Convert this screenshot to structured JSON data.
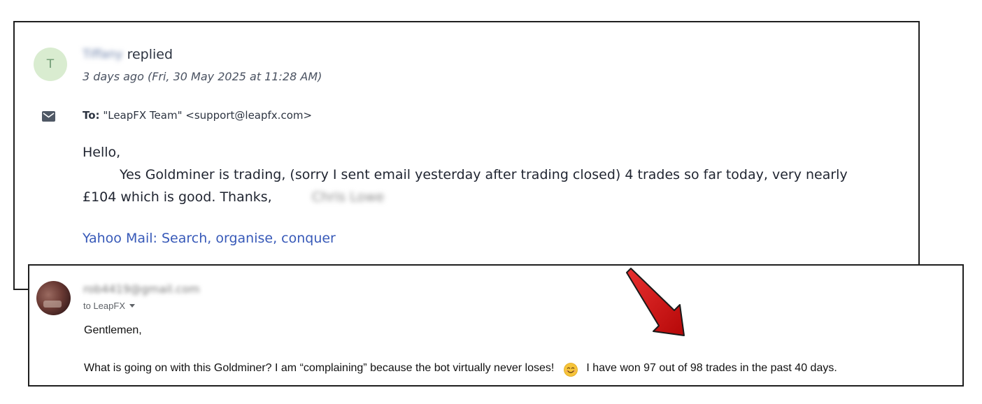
{
  "reply": {
    "avatar_letter": "T",
    "sender_name": "Tiffany",
    "replied_label": "replied",
    "date": "3 days ago (Fri, 30 May 2025 at 11:28 AM)",
    "to_label": "To:",
    "to_value": "\"LeapFX Team\" <support@leapfx.com>",
    "greeting": "Hello,",
    "body_text": "Yes Goldminer is trading, (sorry I sent email yesterday  after trading closed) 4 trades so far today, very nearly £104 which is good. Thanks,",
    "signature": "Chris Lowe",
    "footer_link": "Yahoo Mail: Search, organise, conquer"
  },
  "original": {
    "sender_email": "rob4419@gmail.com",
    "to_label": "to LeapFX",
    "greeting": "Gentlemen,",
    "body_before_emoji": "What is going on with this Goldminer? I am “complaining” because the bot virtually never loses!",
    "body_after_emoji": "I have won 97 out of 98 trades in the past 40 days."
  },
  "icons": {
    "mail": "envelope-icon",
    "emoji": "smiling-face-emoji",
    "dropdown": "chevron-down-icon",
    "annotation": "red-arrow"
  },
  "colors": {
    "link": "#3759b8",
    "avatar_bg": "#d9ecd0",
    "arrow": "#d11010"
  }
}
